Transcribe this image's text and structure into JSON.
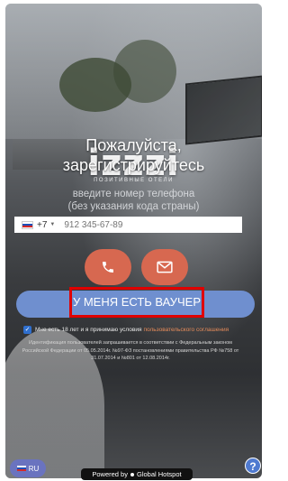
{
  "header": {
    "title_line1": "Пожалуйста,",
    "title_line2": "зарегистрируйтесь",
    "logo_text": "izzzi",
    "logo_tagline": "ПОЗИТИВНЫЕ ОТЕЛИ"
  },
  "instructions": {
    "line1": "введите номер телефона",
    "line2": "(без указания кода страны)"
  },
  "phone": {
    "country_code": "+7",
    "placeholder": "912 345-67-89",
    "flag_colors": [
      "#ffffff",
      "#1c4fb8",
      "#d22a2a"
    ]
  },
  "actions": {
    "call_icon": "phone-icon",
    "email_icon": "envelope-icon",
    "voucher_label": "У МЕНЯ ЕСТЬ ВАУЧЕР",
    "accent_color": "#d76850",
    "voucher_color": "#6f8fcf",
    "highlight_color": "#e00000"
  },
  "consent": {
    "checked": true,
    "text": "Мне есть 18 лет и я принимаю условия",
    "link": "пользовательского соглашения"
  },
  "legal": {
    "text": "Идентификация пользователей запрашивается в соответствии с Федеральным законом Российской Федерации от 05.05.2014г. №97-ФЗ постановлениями правительства РФ №758 от 31.07.2014 и №801 от 12.08.2014г."
  },
  "footer": {
    "language": "RU",
    "powered_prefix": "Powered by",
    "powered_brand": "Global Hotspot",
    "help": "?"
  }
}
